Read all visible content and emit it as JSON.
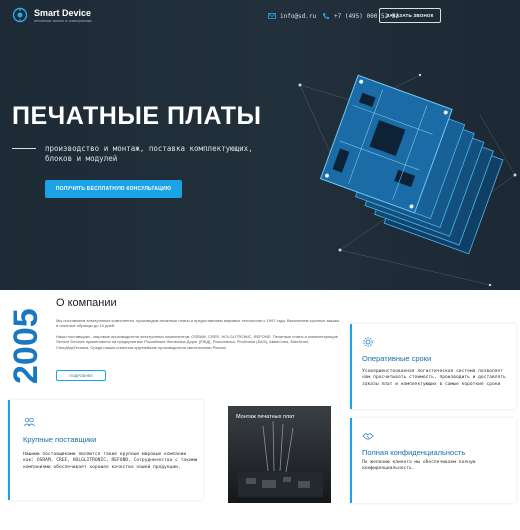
{
  "header": {
    "logo_name": "Smart Device",
    "logo_tagline": "печатные платы и электроника",
    "email": "info@sd.ru",
    "phone": "+7 (495) 000 52 52",
    "callback_label": "ЗАКАЗАТЬ ЗВОНОК"
  },
  "hero": {
    "title": "ПЕЧАТНЫЕ ПЛАТЫ",
    "subtitle": "производство и монтаж, поставка комплектующих, блоков и модулей",
    "cta_label": "ПОЛУЧИТЬ БЕСПЛАТНУЮ КОНСУЛЬТАЦИЮ"
  },
  "about": {
    "year": "2005",
    "title": "О компании",
    "paragraph1": "Мы поставляем электронные компоненты, производим печатные платы и предоставляем мировые технологии с 1997 года. Выполняем срочные заказы и опытные образцы до 10 дней.",
    "paragraph2": "Наши поставщики - мировые производители электронных компонентов: OSRAM, CREE, HOLGLITRONIC, REFOND. Печатные платы и комплектующие Service Devices применяются на предприятиях Российских Железных Дорог (РЖД), Роскосмоса, РосАтома (БАЭ), АвиаСоюз, МинАтом, СпецМедТехника. Среди наших клиентов крупнейшие производители светотехники России.",
    "more_label": "ПОДРОБНЕЕ"
  },
  "cards": {
    "suppliers": {
      "icon": "people-icon",
      "title": "Крупные поставщики",
      "text": "Нашими поставщиками являются такие крупные мировые компании как: OSRAM, CREE, HOLGLITRONIC, REFOND. Сотрудничество с такими компаниями обеспечивает хорошее качество нашей продукции."
    },
    "mounting": {
      "label": "Монтаж печатных плат"
    },
    "deadlines": {
      "icon": "gear-icon",
      "title": "Оперативные сроки",
      "text": "Усовершенствованная логистическая система позволяет нам просчитывать стоимость, производить и доставлять заказы плат и комплектующих в самые короткие сроки"
    },
    "privacy": {
      "icon": "handshake-icon",
      "title": "Полная конфиденциальность",
      "text": "По желанию клиента мы обеспечиваем полную конфиденциальность."
    }
  },
  "colors": {
    "accent": "#1aa3e6",
    "hero_bg": "#1e2b36",
    "link_blue": "#1a6fa8"
  }
}
